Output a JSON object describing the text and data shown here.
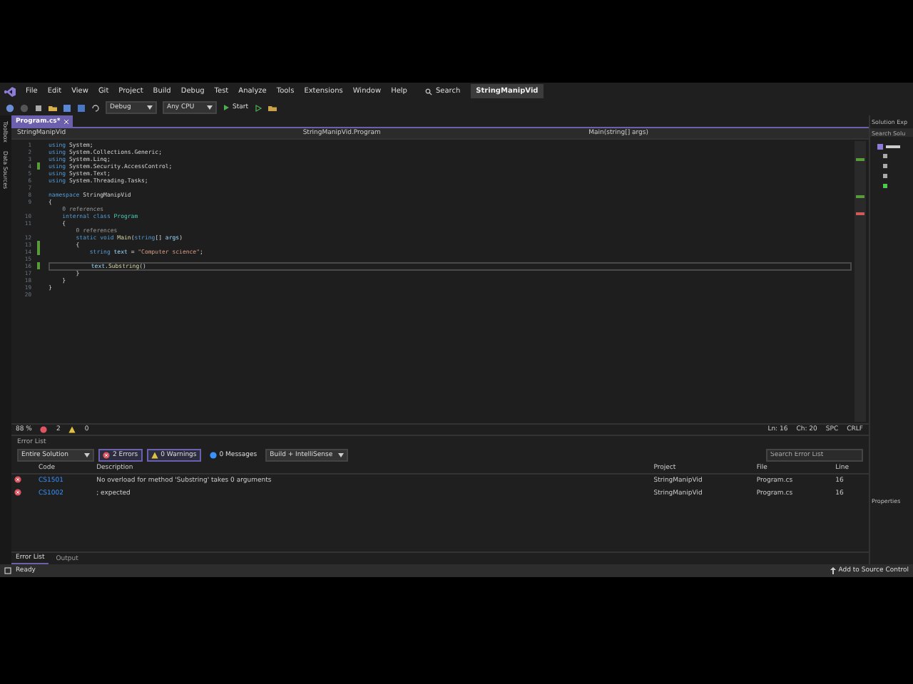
{
  "menu": {
    "items": [
      "File",
      "Edit",
      "View",
      "Git",
      "Project",
      "Build",
      "Debug",
      "Test",
      "Analyze",
      "Tools",
      "Extensions",
      "Window",
      "Help"
    ],
    "search": "Search",
    "solution_badge": "StringManipVid"
  },
  "toolbar": {
    "configuration": "Debug",
    "platform": "Any CPU",
    "start": "Start"
  },
  "side_strip": [
    "Toolbox",
    "Data Sources"
  ],
  "document_tabs": [
    {
      "label": "Program.cs*",
      "selected": true
    }
  ],
  "nav_bar": [
    "StringManipVid",
    "StringManipVid.Program",
    "Main(string[] args)"
  ],
  "code": {
    "lines": [
      {
        "kind": "code",
        "num": "1",
        "changed": false,
        "current": false,
        "tokens": [
          {
            "kind": "kw",
            "text": "using"
          },
          {
            "kind": "p",
            "text": " System;"
          }
        ]
      },
      {
        "kind": "code",
        "num": "2",
        "changed": false,
        "current": false,
        "tokens": [
          {
            "kind": "kw",
            "text": "using"
          },
          {
            "kind": "p",
            "text": " System.Collections.Generic;"
          }
        ]
      },
      {
        "kind": "code",
        "num": "3",
        "changed": false,
        "current": false,
        "tokens": [
          {
            "kind": "kw",
            "text": "using"
          },
          {
            "kind": "p",
            "text": " System.Linq;"
          }
        ]
      },
      {
        "kind": "code",
        "num": "4",
        "changed": true,
        "current": false,
        "tokens": [
          {
            "kind": "kw",
            "text": "using"
          },
          {
            "kind": "p",
            "text": " System.Security.AccessControl;"
          }
        ]
      },
      {
        "kind": "code",
        "num": "5",
        "changed": false,
        "current": false,
        "tokens": [
          {
            "kind": "kw",
            "text": "using"
          },
          {
            "kind": "p",
            "text": " System.Text;"
          }
        ]
      },
      {
        "kind": "code",
        "num": "6",
        "changed": false,
        "current": false,
        "tokens": [
          {
            "kind": "kw",
            "text": "using"
          },
          {
            "kind": "p",
            "text": " System.Threading.Tasks;"
          }
        ]
      },
      {
        "kind": "code",
        "num": "7",
        "changed": false,
        "current": false
      },
      {
        "kind": "code",
        "num": "8",
        "changed": false,
        "current": false,
        "tokens": [
          {
            "kind": "kw",
            "text": "namespace"
          },
          {
            "kind": "p",
            "text": " StringManipVid"
          }
        ]
      },
      {
        "kind": "code",
        "num": "9",
        "changed": false,
        "current": false,
        "tokens": [
          {
            "kind": "p",
            "text": "{"
          }
        ]
      },
      {
        "kind": "lens",
        "text": "    0 references"
      },
      {
        "kind": "code",
        "num": "10",
        "changed": false,
        "current": false,
        "tokens": [
          {
            "kind": "kw",
            "text": "    internal class "
          },
          {
            "kind": "type",
            "text": "Program"
          }
        ]
      },
      {
        "kind": "code",
        "num": "11",
        "changed": false,
        "current": false,
        "tokens": [
          {
            "kind": "p",
            "text": "    {"
          }
        ]
      },
      {
        "kind": "lens",
        "text": "        0 references"
      },
      {
        "kind": "code",
        "num": "12",
        "changed": false,
        "current": false,
        "tokens": [
          {
            "kind": "kw",
            "text": "        static void "
          },
          {
            "kind": "method",
            "text": "Main"
          },
          {
            "kind": "p",
            "text": "("
          },
          {
            "kind": "kw",
            "text": "string"
          },
          {
            "kind": "p",
            "text": "[] "
          },
          {
            "kind": "ident",
            "text": "args"
          },
          {
            "kind": "p",
            "text": ")"
          }
        ]
      },
      {
        "kind": "code",
        "num": "13",
        "changed": true,
        "current": false,
        "tokens": [
          {
            "kind": "p",
            "text": "        {"
          }
        ]
      },
      {
        "kind": "code",
        "num": "14",
        "changed": true,
        "current": false,
        "tokens": [
          {
            "kind": "kw",
            "text": "            string "
          },
          {
            "kind": "ident",
            "text": "text"
          },
          {
            "kind": "p",
            "text": " = "
          },
          {
            "kind": "str",
            "text": "\"Computer science\""
          },
          {
            "kind": "p",
            "text": ";"
          }
        ]
      },
      {
        "kind": "code",
        "num": "15",
        "changed": false,
        "current": false
      },
      {
        "kind": "code",
        "num": "16",
        "changed": true,
        "current": true,
        "tokens": [
          {
            "kind": "ident",
            "text": "            text"
          },
          {
            "kind": "p",
            "text": "."
          },
          {
            "kind": "method",
            "text": "Substring"
          },
          {
            "kind": "p",
            "text": "()"
          }
        ]
      },
      {
        "kind": "code",
        "num": "17",
        "changed": false,
        "current": false,
        "tokens": [
          {
            "kind": "p",
            "text": "        }"
          }
        ]
      },
      {
        "kind": "code",
        "num": "18",
        "changed": false,
        "current": false,
        "tokens": [
          {
            "kind": "p",
            "text": "    }"
          }
        ]
      },
      {
        "kind": "code",
        "num": "19",
        "changed": false,
        "current": false,
        "tokens": [
          {
            "kind": "p",
            "text": "}"
          }
        ]
      },
      {
        "kind": "code",
        "num": "20",
        "changed": false,
        "current": false
      }
    ]
  },
  "editor_status": {
    "zoom": "88 %",
    "errors": "2",
    "warnings": "0",
    "line": "Ln: 16",
    "char": "Ch: 20",
    "spacing": "SPC",
    "line_ending": "CRLF"
  },
  "error_list": {
    "title": "Error List",
    "scope": "Entire Solution",
    "filters": [
      {
        "label": "2 Errors",
        "kind": "error",
        "selected": true
      },
      {
        "label": "0 Warnings",
        "kind": "warning",
        "selected": true
      },
      {
        "label": "0 Messages",
        "kind": "info",
        "selected": false
      }
    ],
    "source": "Build + IntelliSense",
    "search_placeholder": "Search Error List",
    "columns": [
      "Code",
      "Description",
      "Project",
      "File",
      "Line"
    ],
    "rows": [
      {
        "code": "CS1501",
        "description": "No overload for method 'Substring' takes 0 arguments",
        "project": "StringManipVid",
        "file": "Program.cs",
        "line": "16"
      },
      {
        "code": "CS1002",
        "description": "; expected",
        "project": "StringManipVid",
        "file": "Program.cs",
        "line": "16"
      }
    ]
  },
  "bottom_tabs": [
    {
      "label": "Error List",
      "selected": true
    },
    {
      "label": "Output",
      "selected": false
    }
  ],
  "solution_explorer": {
    "title": "Solution Exp",
    "search_placeholder": "Search Solu",
    "properties": "Properties"
  },
  "status_bar": {
    "text": "Ready",
    "source_control": "Add to Source Control"
  }
}
